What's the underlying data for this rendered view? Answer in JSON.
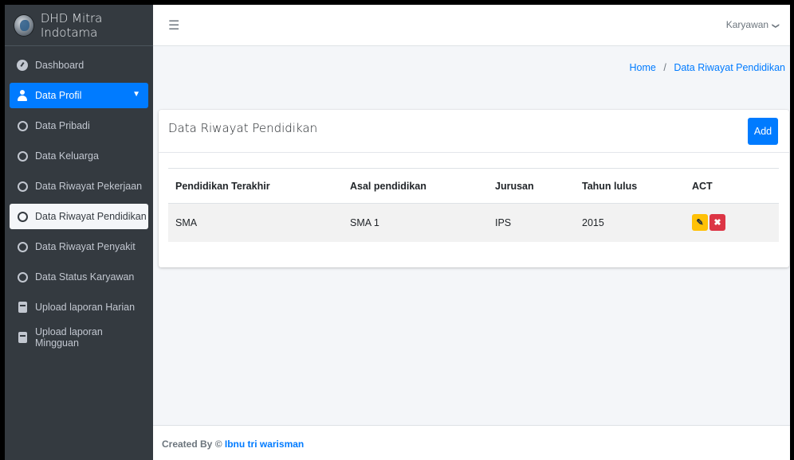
{
  "brand": {
    "title": "DHD Mitra Indotama"
  },
  "topbar": {
    "menu_icon": "hamburger-icon",
    "user_label": "Karyawan",
    "user_chevron": "❯"
  },
  "sidebar": {
    "items": [
      {
        "label": "Dashboard",
        "icon": "dashboard-icon"
      },
      {
        "label": "Data Profil",
        "icon": "user-icon"
      },
      {
        "label": "Data Pribadi",
        "icon": "circle-icon"
      },
      {
        "label": "Data Keluarga",
        "icon": "circle-icon"
      },
      {
        "label": "Data Riwayat Pekerjaan",
        "icon": "circle-icon"
      },
      {
        "label": "Data Riwayat Pendidikan",
        "icon": "circle-icon"
      },
      {
        "label": "Data Riwayat Penyakit",
        "icon": "circle-icon"
      },
      {
        "label": "Data Status Karyawan",
        "icon": "circle-icon"
      },
      {
        "label": "Upload laporan Harian",
        "icon": "book-icon"
      },
      {
        "label": "Upload laporan Mingguan",
        "icon": "book-icon"
      }
    ]
  },
  "breadcrumb": {
    "home": "Home",
    "separator": "/",
    "current": "Data Riwayat Pendidikan"
  },
  "card": {
    "title": "Data Riwayat Pendidikan",
    "add_label": "Add",
    "columns": [
      "Pendidikan Terakhir",
      "Asal pendidikan",
      "Jurusan",
      "Tahun lulus",
      "ACT"
    ],
    "rows": [
      {
        "pendidikan": "SMA",
        "asal": "SMA 1",
        "jurusan": "IPS",
        "tahun": "2015"
      }
    ],
    "edit_glyph": "✎",
    "delete_glyph": "✖"
  },
  "footer": {
    "prefix": "Created By ©",
    "author": "Ibnu tri warisman"
  },
  "colors": {
    "sidebar": "#343a40",
    "primary": "#007bff",
    "warning": "#ffc107",
    "danger": "#dc3545"
  }
}
